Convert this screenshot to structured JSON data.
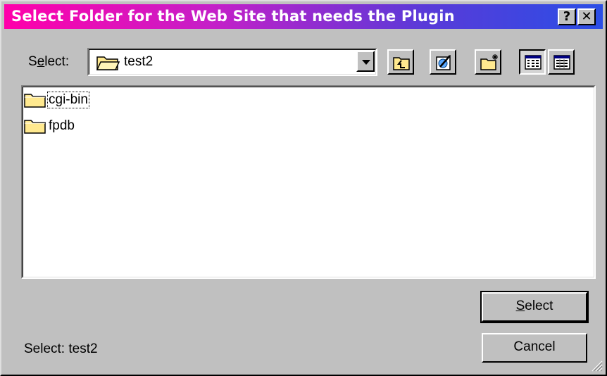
{
  "window": {
    "title": "Select Folder for the Web Site that needs the Plugin",
    "help_button": "?",
    "close_button": "✕"
  },
  "toolbar": {
    "select_label": "Select:",
    "select_label_hotkey": "e",
    "current_folder": "test2",
    "buttons": [
      "up-one-level",
      "browse-web",
      "create-new-folder",
      "list-view",
      "details-view"
    ],
    "pressed_button": "list-view"
  },
  "folders": [
    {
      "name": "cgi-bin",
      "focused": true
    },
    {
      "name": "fpdb",
      "focused": false
    }
  ],
  "buttons": {
    "select": "Select",
    "cancel": "Cancel"
  },
  "status": "Select: test2",
  "colors": {
    "title_gradient_start": "#ff00aa",
    "title_gradient_end": "#2a4ee6",
    "face": "#c0c0c0",
    "folder": "#ffe98f"
  }
}
